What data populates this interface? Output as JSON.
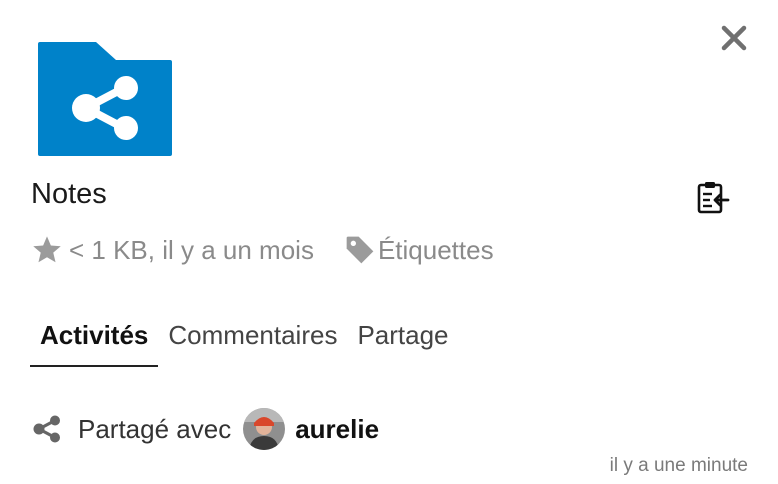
{
  "file": {
    "name": "Notes",
    "meta": "< 1 KB, il y a un mois",
    "tags_label": "Étiquettes"
  },
  "tabs": [
    {
      "label": "Activités",
      "active": true
    },
    {
      "label": "Commentaires",
      "active": false
    },
    {
      "label": "Partage",
      "active": false
    }
  ],
  "activity": {
    "text": "Partagé avec",
    "user": "aurelie",
    "time": "il y a une minute"
  },
  "colors": {
    "folder": "#0082c9",
    "icon_gray": "#9b9b9b",
    "close_gray": "#707070"
  },
  "icons": [
    "close-icon",
    "shared-folder-icon",
    "clipboard-icon",
    "star-icon",
    "tag-icon",
    "share-icon",
    "avatar"
  ]
}
